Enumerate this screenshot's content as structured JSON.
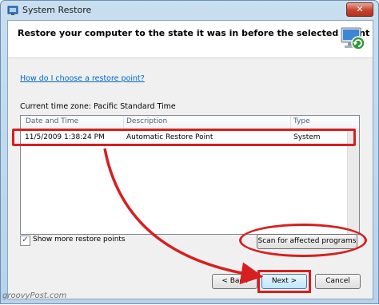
{
  "window": {
    "title": "System Restore",
    "close_glyph": "✕"
  },
  "header": {
    "heading": "Restore your computer to the state it was in before the selected event",
    "icon": "system-restore-icon"
  },
  "help_link": "How do I choose a restore point?",
  "timezone_label": "Current time zone: Pacific Standard Time",
  "list": {
    "columns": [
      "Date and Time",
      "Description",
      "Type"
    ],
    "rows": [
      {
        "date_time": "11/5/2009 1:38:24 PM",
        "description": "Automatic Restore Point",
        "type": "System"
      }
    ]
  },
  "show_more": {
    "label": "Show more restore points",
    "checked": true,
    "check_glyph": "✓"
  },
  "buttons": {
    "scan": "Scan for affected programs",
    "back": "< Back",
    "next": "Next >",
    "cancel": "Cancel"
  },
  "watermark": "groovyPost.com",
  "colors": {
    "annotation_red": "#d71f1f",
    "link_blue": "#0066cc"
  }
}
